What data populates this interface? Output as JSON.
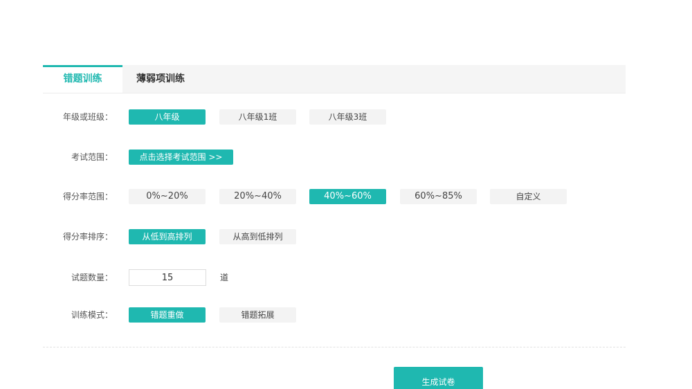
{
  "tabs": {
    "active": "错题训练",
    "other": "薄弱项训练"
  },
  "grade": {
    "label": "年级或班级：",
    "options": [
      "八年级",
      "八年级1班",
      "八年级3班"
    ],
    "selected": "八年级"
  },
  "exam_scope": {
    "label": "考试范围：",
    "button": "点击选择考试范围 >>"
  },
  "score_range": {
    "label": "得分率范围：",
    "options": [
      "0%~20%",
      "20%~40%",
      "40%~60%",
      "60%~85%",
      "自定义"
    ],
    "selected": "40%~60%"
  },
  "score_sort": {
    "label": "得分率排序：",
    "options": [
      "从低到高排列",
      "从高到低排列"
    ],
    "selected": "从低到高排列"
  },
  "quantity": {
    "label": "试题数量：",
    "value": "15",
    "unit": "道"
  },
  "train_mode": {
    "label": "训练模式：",
    "options": [
      "错题重做",
      "错题拓展"
    ],
    "selected": "错题重做"
  },
  "generate_button": "生成试卷",
  "colors": {
    "accent": "#1fb8b0",
    "option_bg": "#f3f3f3",
    "tabbar_bg": "#f5f5f5"
  }
}
